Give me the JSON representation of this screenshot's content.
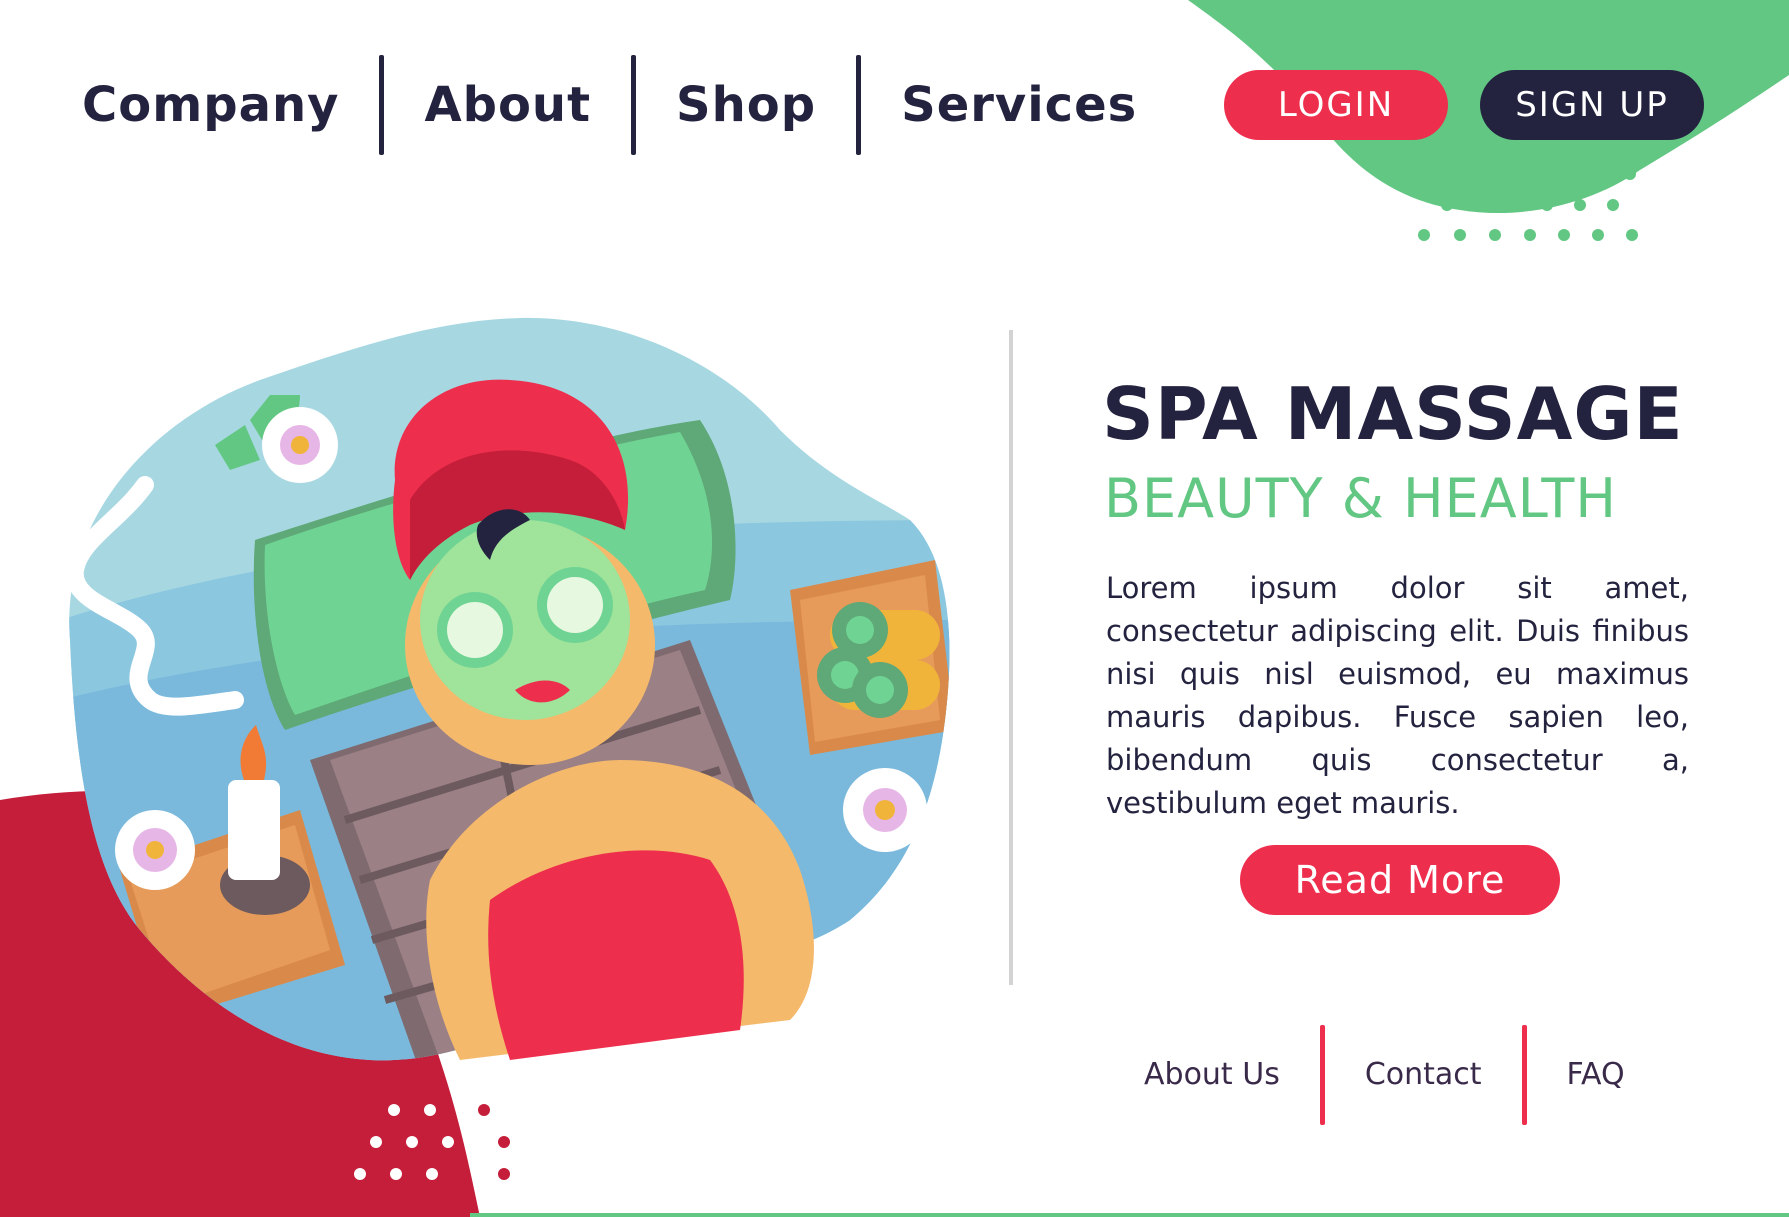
{
  "nav": {
    "items": [
      {
        "label": "Company"
      },
      {
        "label": "About"
      },
      {
        "label": "Shop"
      },
      {
        "label": "Services"
      }
    ]
  },
  "auth": {
    "login_label": "LOGIN",
    "signup_label": "SIGN UP"
  },
  "hero": {
    "title": "SPA MASSAGE",
    "subtitle": "BEAUTY & HEALTH",
    "body": "Lorem ipsum dolor sit amet, consectetur adipiscing elit. Duis finibus nisi quis nisl euismod, eu maximus mauris dapibus. Fusce sapien leo, bibendum quis consectetur a, vestibulum eget mauris.",
    "cta_label": "Read More"
  },
  "footer": {
    "links": [
      {
        "label": "About Us"
      },
      {
        "label": "Contact"
      },
      {
        "label": "FAQ"
      }
    ]
  },
  "colors": {
    "navy": "#23233f",
    "accent_red": "#ee2e4d",
    "accent_green": "#62c782",
    "crimson": "#c41e3a",
    "sky": "#a7d8e2"
  }
}
